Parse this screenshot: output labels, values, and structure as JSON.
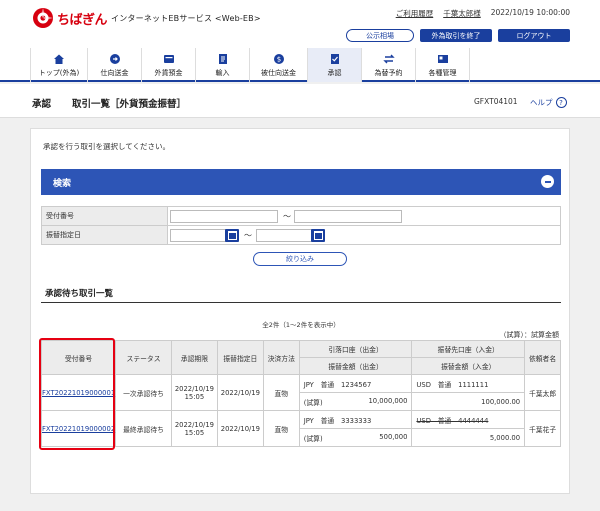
{
  "header": {
    "logo_text": "ちばぎん",
    "service_name": "インターネットEBサービス <Web-EB>",
    "usage_history": "ご利用履歴",
    "user_name": "千葉太郎様",
    "datetime": "2022/10/19 10:00:00",
    "btn_public_rates": "公示相場",
    "btn_end_fx": "外為取引を終了",
    "btn_logout": "ログアウト",
    "brand_color": "#d7000f",
    "accent_color": "#1a3f9e"
  },
  "nav": {
    "items": [
      {
        "label": "トップ(外為)",
        "icon": "home-icon"
      },
      {
        "label": "仕向送金",
        "icon": "send-money-icon"
      },
      {
        "label": "外貨預金",
        "icon": "deposit-icon"
      },
      {
        "label": "輸入",
        "icon": "import-icon"
      },
      {
        "label": "被仕向送金",
        "icon": "receive-money-icon"
      },
      {
        "label": "承認",
        "icon": "approval-icon"
      },
      {
        "label": "為替予約",
        "icon": "exchange-icon"
      },
      {
        "label": "各種管理",
        "icon": "management-icon"
      }
    ],
    "active_index": 5
  },
  "page": {
    "title": "承認",
    "subtitle": "取引一覧［外貨預金振替］",
    "screen_code": "GFXT04101",
    "help": "ヘルプ",
    "instruction": "承認を行う取引を選択してください。"
  },
  "search": {
    "title": "検索",
    "receipt_no_label": "受付番号",
    "transfer_date_label": "振替指定日",
    "range_sep": "～",
    "narrow_button": "絞り込み"
  },
  "list": {
    "title": "承認待ち取引一覧",
    "count_text": "全2件（1～2件を表示中）",
    "trial_note": "（試算）：試算金額",
    "headers": {
      "receipt_no": "受付番号",
      "status": "ステータス",
      "deadline": "承認期限",
      "transfer_date": "振替指定日",
      "settlement": "決済方法",
      "debit": "引落口座（出金）",
      "debit_amount": "振替金額（出金）",
      "credit": "振替先口座（入金）",
      "credit_amount": "振替金額（入金）",
      "requester": "依頼者名"
    },
    "rows": [
      {
        "receipt_no": "FXT20221019000001",
        "status": "一次承認待ち",
        "deadline_date": "2022/10/19",
        "deadline_time": "15:05",
        "transfer_date": "2022/10/19",
        "settlement": "直物",
        "debit_account": "JPY　普通　1234567",
        "debit_amount_label": "(試算)",
        "debit_amount": "10,000,000",
        "credit_account": "USD　普通　1111111",
        "credit_amount": "100,000.00",
        "requester": "千葉太郎",
        "credit_strike": false
      },
      {
        "receipt_no": "FXT20221019000002",
        "status": "最終承認待ち",
        "deadline_date": "2022/10/19",
        "deadline_time": "15:05",
        "transfer_date": "2022/10/19",
        "settlement": "直物",
        "debit_account": "JPY　普通　3333333",
        "debit_amount_label": "(試算)",
        "debit_amount": "500,000",
        "credit_account": "USD　普通　4444444",
        "credit_amount": "5,000.00",
        "requester": "千葉花子",
        "credit_strike": true
      }
    ]
  }
}
